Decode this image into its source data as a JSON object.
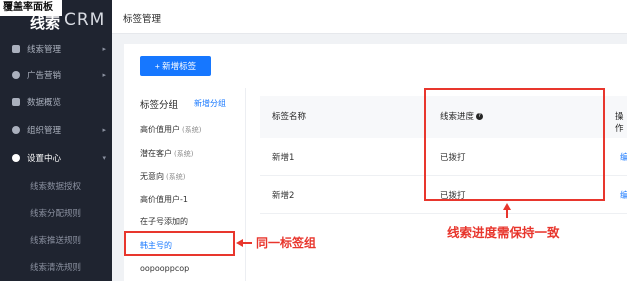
{
  "badge": {
    "coverage": "覆盖率面板"
  },
  "logo": {
    "mark": "线索",
    "crm": "CRM"
  },
  "sidebar": {
    "items": [
      {
        "label": "线索管理",
        "icon": "book-icon",
        "arrow": "▸"
      },
      {
        "label": "广告营销",
        "icon": "target-icon",
        "arrow": "▸"
      },
      {
        "label": "数据概览",
        "icon": "chart-icon",
        "arrow": ""
      },
      {
        "label": "组织管理",
        "icon": "org-icon",
        "arrow": "▸"
      },
      {
        "label": "设置中心",
        "icon": "gear-icon",
        "arrow": "▾"
      }
    ],
    "sub_items": [
      "线索数据授权",
      "线索分配规则",
      "线索推送规则",
      "线索清洗规则"
    ]
  },
  "header": {
    "title": "标签管理"
  },
  "toolbar": {
    "add_label": "+ 新增标签"
  },
  "groups": {
    "title": "标签分组",
    "add_link": "新增分组",
    "items": [
      {
        "label": "高价值用户",
        "tag": "(系统)"
      },
      {
        "label": "潜在客户",
        "tag": "(系统)"
      },
      {
        "label": "无意向",
        "tag": "(系统)"
      },
      {
        "label": "高价值用户-1",
        "tag": ""
      },
      {
        "label": "在子号添加的",
        "tag": ""
      },
      {
        "label": "韩主号的",
        "tag": ""
      },
      {
        "label": "oopooppcop",
        "tag": ""
      }
    ]
  },
  "table": {
    "headers": {
      "name": "标签名称",
      "progress": "线索进度",
      "ops": "操作"
    },
    "help_icon": "?",
    "rows": [
      {
        "name": "新增1",
        "progress": "已拨打",
        "op": "编"
      },
      {
        "name": "新增2",
        "progress": "已拨打",
        "op": "编"
      }
    ]
  },
  "annotations": {
    "same_group": "同一标签组",
    "consistent": "线索进度需保持一致",
    "color": "#e8362d"
  }
}
